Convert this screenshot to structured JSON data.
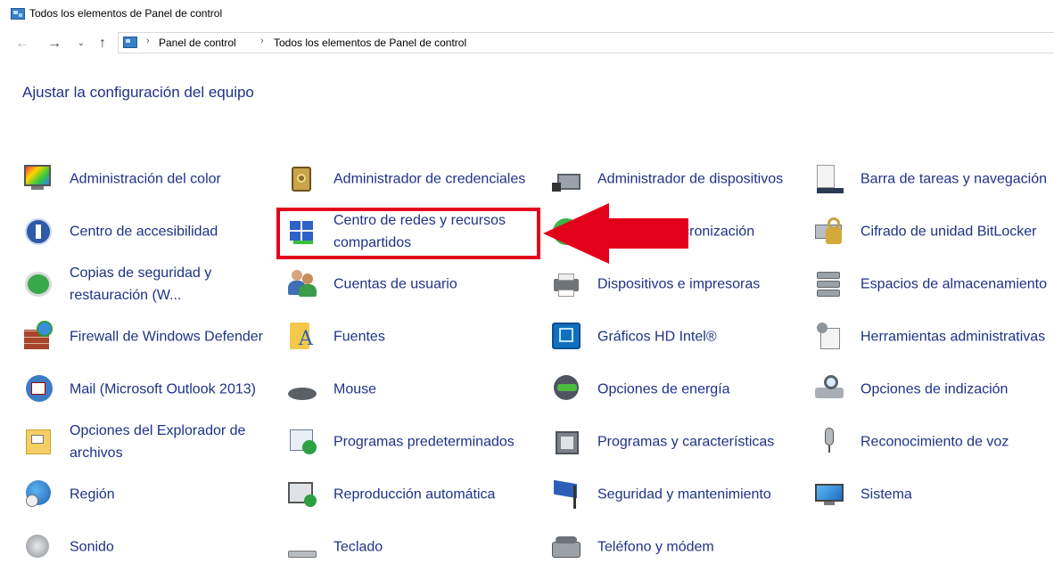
{
  "window": {
    "title": "Todos los elementos de Panel de control"
  },
  "nav": {
    "back": "←",
    "forward": "→",
    "recent": "⌄",
    "up": "↑"
  },
  "breadcrumb": {
    "sep": "›",
    "items": [
      "Panel de control",
      "Todos los elementos de Panel de control"
    ]
  },
  "heading": "Ajustar la configuración del equipo",
  "colors": {
    "link": "#1e3287",
    "highlight": "#e3001b",
    "arrow": "#e3001b"
  },
  "items": [
    {
      "label": "Administración del color",
      "icon": "color-management-icon"
    },
    {
      "label": "Administrador de credenciales",
      "icon": "credential-manager-icon"
    },
    {
      "label": "Administrador de dispositivos",
      "icon": "device-manager-icon"
    },
    {
      "label": "Barra de tareas y navegación",
      "icon": "taskbar-icon"
    },
    {
      "label": "Centro de accesibilidad",
      "icon": "accessibility-icon"
    },
    {
      "label": "Centro de redes y recursos compartidos",
      "icon": "network-center-icon"
    },
    {
      "label": "Centro de sincronización",
      "icon": "sync-center-icon"
    },
    {
      "label": "Cifrado de unidad BitLocker",
      "icon": "bitlocker-icon"
    },
    {
      "label": "Copias de seguridad y restauración (W...",
      "icon": "backup-icon"
    },
    {
      "label": "Cuentas de usuario",
      "icon": "user-accounts-icon"
    },
    {
      "label": "Dispositivos e impresoras",
      "icon": "printer-icon"
    },
    {
      "label": "Espacios de almacenamiento",
      "icon": "storage-spaces-icon"
    },
    {
      "label": "Firewall de Windows Defender",
      "icon": "firewall-icon"
    },
    {
      "label": "Fuentes",
      "icon": "fonts-icon"
    },
    {
      "label": "Gráficos HD Intel®",
      "icon": "intel-graphics-icon"
    },
    {
      "label": "Herramientas administrativas",
      "icon": "admin-tools-icon"
    },
    {
      "label": "Mail (Microsoft Outlook 2013)",
      "icon": "mail-icon"
    },
    {
      "label": "Mouse",
      "icon": "mouse-icon"
    },
    {
      "label": "Opciones de energía",
      "icon": "power-icon"
    },
    {
      "label": "Opciones de indización",
      "icon": "indexing-icon"
    },
    {
      "label": "Opciones del Explorador de archivos",
      "icon": "folder-options-icon"
    },
    {
      "label": "Programas predeterminados",
      "icon": "default-programs-icon"
    },
    {
      "label": "Programas y características",
      "icon": "programs-features-icon"
    },
    {
      "label": "Reconocimiento de voz",
      "icon": "microphone-icon"
    },
    {
      "label": "Región",
      "icon": "region-icon"
    },
    {
      "label": "Reproducción automática",
      "icon": "autoplay-icon"
    },
    {
      "label": "Seguridad y mantenimiento",
      "icon": "security-flag-icon"
    },
    {
      "label": "Sistema",
      "icon": "system-icon"
    },
    {
      "label": "Sonido",
      "icon": "sound-icon"
    },
    {
      "label": "Teclado",
      "icon": "keyboard-icon"
    },
    {
      "label": "Teléfono y módem",
      "icon": "phone-modem-icon"
    }
  ]
}
